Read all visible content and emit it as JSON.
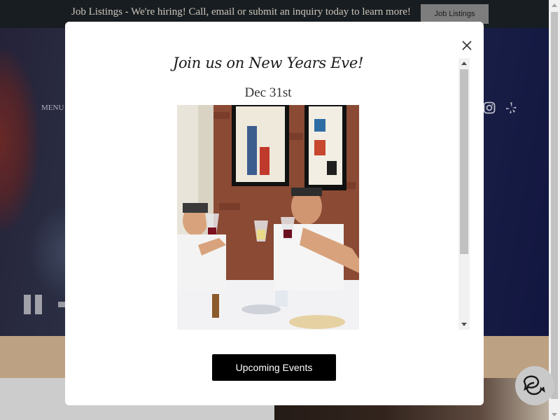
{
  "announcement": {
    "text": "Job Listings - We're hiring! Call, email or submit an inquiry today to learn more!",
    "button_label": "Job Listings"
  },
  "hero": {
    "menu_label": "MENU"
  },
  "modal": {
    "title": "Join us on New Years Eve!",
    "date": "Dec 31st",
    "cta_label": "Upcoming Events",
    "close_icon": "close-icon"
  },
  "icons": {
    "instagram": "instagram-icon",
    "yelp": "yelp-icon",
    "chat": "chat-icon",
    "pause": "pause-icon"
  },
  "colors": {
    "announce_bg": "#1c2126",
    "tan_band": "#d8b896",
    "cta_bg": "#000000"
  }
}
